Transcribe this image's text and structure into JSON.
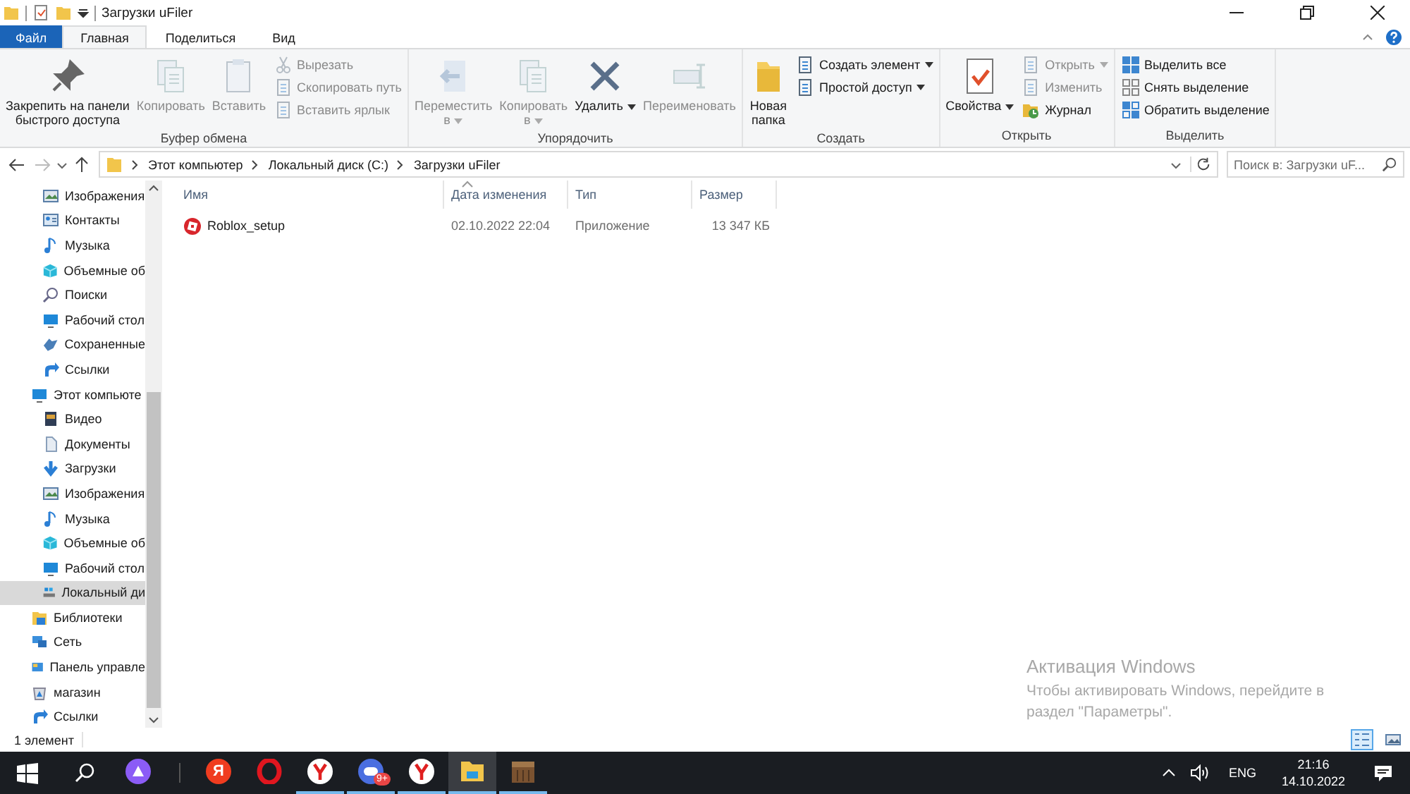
{
  "window": {
    "title": "Загрузки uFiler"
  },
  "tabs": [
    {
      "label": "Файл",
      "kind": "file",
      "selected": false
    },
    {
      "label": "Главная",
      "kind": "tab",
      "selected": true
    },
    {
      "label": "Поделиться",
      "kind": "tab",
      "selected": false
    },
    {
      "label": "Вид",
      "kind": "tab",
      "selected": false
    }
  ],
  "ribbon": {
    "groups": [
      {
        "label": "Буфер обмена",
        "items": [
          {
            "kind": "large",
            "label": "Закрепить на панели\nбыстрого доступа",
            "disabled": false,
            "dropdown": false
          },
          {
            "kind": "large",
            "label": "Копировать",
            "disabled": true,
            "dropdown": false
          },
          {
            "kind": "large",
            "label": "Вставить",
            "disabled": true,
            "dropdown": false
          },
          {
            "kind": "small",
            "label": "Вырезать",
            "disabled": true,
            "dropdown": false
          },
          {
            "kind": "small",
            "label": "Скопировать путь",
            "disabled": true,
            "dropdown": false
          },
          {
            "kind": "small",
            "label": "Вставить ярлык",
            "disabled": true,
            "dropdown": false
          }
        ]
      },
      {
        "label": "Упорядочить",
        "items": [
          {
            "kind": "large",
            "label": "Переместить\nв",
            "disabled": true,
            "dropdown": true
          },
          {
            "kind": "large",
            "label": "Копировать\nв",
            "disabled": true,
            "dropdown": true
          },
          {
            "kind": "large",
            "label": "Удалить",
            "disabled": false,
            "dropdown": true
          },
          {
            "kind": "large",
            "label": "Переименовать",
            "disabled": true,
            "dropdown": false
          }
        ]
      },
      {
        "label": "Создать",
        "items": [
          {
            "kind": "large",
            "label": "Новая\nпапка",
            "disabled": false,
            "dropdown": false
          },
          {
            "kind": "small",
            "label": "Создать элемент",
            "disabled": false,
            "dropdown": true
          },
          {
            "kind": "small",
            "label": "Простой доступ",
            "disabled": false,
            "dropdown": true
          }
        ]
      },
      {
        "label": "Открыть",
        "items": [
          {
            "kind": "large",
            "label": "Свойства",
            "disabled": false,
            "dropdown": true
          },
          {
            "kind": "small",
            "label": "Открыть",
            "disabled": true,
            "dropdown": true
          },
          {
            "kind": "small",
            "label": "Изменить",
            "disabled": true,
            "dropdown": false
          },
          {
            "kind": "small",
            "label": "Журнал",
            "disabled": false,
            "dropdown": false
          }
        ]
      },
      {
        "label": "Выделить",
        "items": [
          {
            "kind": "small",
            "label": "Выделить все",
            "disabled": false,
            "dropdown": false
          },
          {
            "kind": "small",
            "label": "Снять выделение",
            "disabled": false,
            "dropdown": false
          },
          {
            "kind": "small",
            "label": "Обратить выделение",
            "disabled": false,
            "dropdown": false
          }
        ]
      }
    ]
  },
  "address_bar": {
    "path": [
      "Этот компьютер",
      "Локальный диск (C:)",
      "Загрузки uFiler"
    ],
    "search_placeholder": "Поиск в: Загрузки uF..."
  },
  "sidebar": {
    "items": [
      {
        "children": [
          {
            "label": "Изображения",
            "selected": false
          },
          {
            "label": "Контакты",
            "selected": false
          },
          {
            "label": "Музыка",
            "selected": false
          },
          {
            "label": "Объемные об",
            "selected": false
          },
          {
            "label": "Поиски",
            "selected": false
          },
          {
            "label": "Рабочий стол",
            "selected": false
          },
          {
            "label": "Сохраненные",
            "selected": false
          },
          {
            "label": "Ссылки",
            "selected": false
          }
        ]
      },
      {
        "label": "Этот компьюте",
        "selected": false,
        "children": [
          {
            "label": "Видео",
            "selected": false
          },
          {
            "label": "Документы",
            "selected": false
          },
          {
            "label": "Загрузки",
            "selected": false
          },
          {
            "label": "Изображения",
            "selected": false
          },
          {
            "label": "Музыка",
            "selected": false
          },
          {
            "label": "Объемные об",
            "selected": false
          },
          {
            "label": "Рабочий стол",
            "selected": false
          },
          {
            "label": "Локальный ди",
            "selected": true
          }
        ]
      },
      {
        "label": "Библиотеки",
        "selected": false
      },
      {
        "label": "Сеть",
        "selected": false
      },
      {
        "label": "Панель управле",
        "selected": false
      },
      {
        "label": "магазин",
        "selected": false
      },
      {
        "label": "Ссылки",
        "selected": false
      }
    ]
  },
  "table": {
    "columns": [
      "Имя",
      "Дата изменения",
      "Тип",
      "Размер"
    ],
    "rows": [
      {
        "name": "Roblox_setup",
        "date": "02.10.2022 22:04",
        "type": "Приложение",
        "size": "13 347 КБ",
        "selected": false
      }
    ]
  },
  "activation": {
    "title": "Активация Windows",
    "text": "Чтобы активировать Windows, перейдите в\nраздел \"Параметры\"."
  },
  "status_bar": {
    "count": "1 элемент",
    "views": [
      {
        "kind": "details",
        "selected": true
      },
      {
        "kind": "large-icons",
        "selected": false
      }
    ]
  },
  "taskbar": {
    "apps": [
      {
        "kind": "assistant",
        "running": false,
        "active": false
      },
      {
        "kind": "yandex",
        "glyph": "Я",
        "running": false,
        "active": false
      },
      {
        "kind": "opera",
        "running": false,
        "active": false
      },
      {
        "kind": "browser",
        "running": true,
        "active": false
      },
      {
        "kind": "chat",
        "badge": "9+",
        "running": true,
        "active": false
      },
      {
        "kind": "browser",
        "running": true,
        "active": false
      },
      {
        "kind": "explorer",
        "running": true,
        "active": true
      },
      {
        "kind": "crafting",
        "running": true,
        "active": false
      }
    ],
    "language": "ENG",
    "time": "21:16",
    "date": "14.10.2022"
  }
}
